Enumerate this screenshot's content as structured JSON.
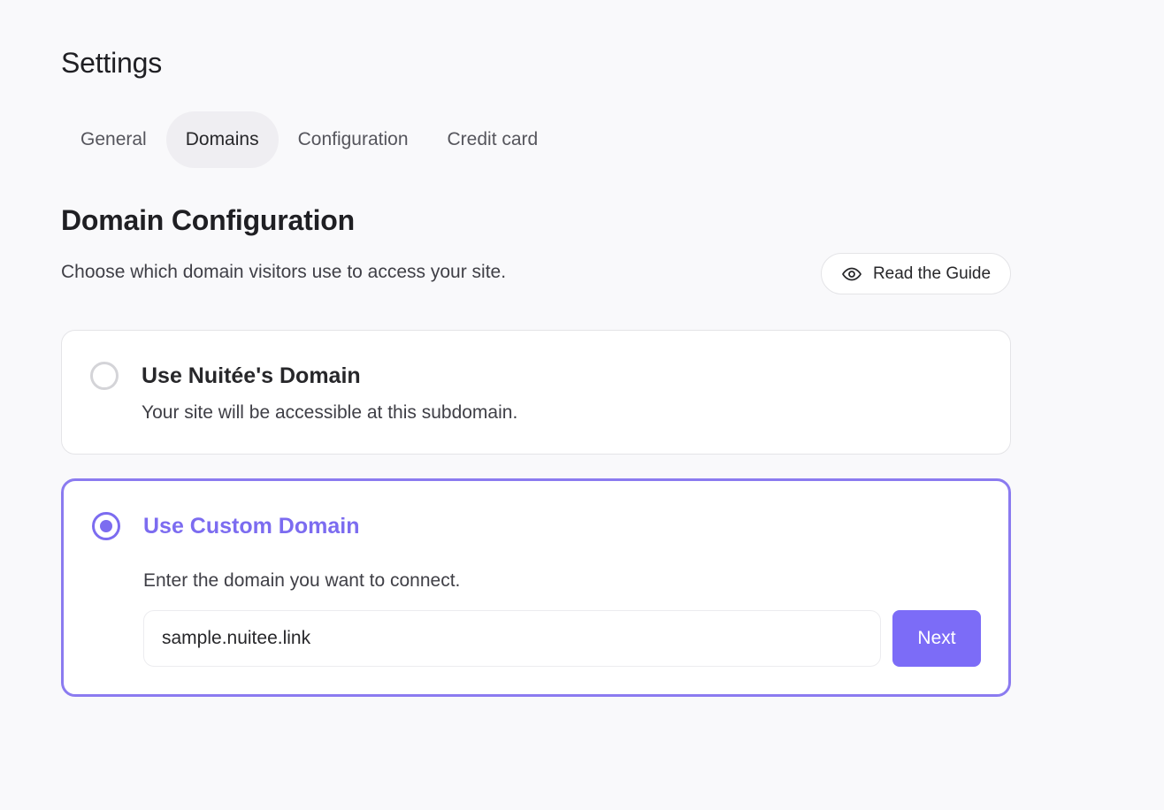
{
  "page": {
    "title": "Settings"
  },
  "tabs": [
    {
      "label": "General",
      "active": false
    },
    {
      "label": "Domains",
      "active": true
    },
    {
      "label": "Configuration",
      "active": false
    },
    {
      "label": "Credit card",
      "active": false
    }
  ],
  "section": {
    "title": "Domain Configuration",
    "description": "Choose which domain visitors use to access your site.",
    "guide_button": {
      "label": "Read the Guide",
      "icon": "eye-icon"
    }
  },
  "options": {
    "nuitee": {
      "title": "Use Nuitée's Domain",
      "description": "Your site will be accessible at this subdomain.",
      "selected": false
    },
    "custom": {
      "title": "Use Custom Domain",
      "description": "Enter the domain you want to connect.",
      "selected": true,
      "input_value": "sample.nuitee.link",
      "next_label": "Next"
    }
  },
  "colors": {
    "accent": "#7c6cf7",
    "background": "#f9f9fb",
    "card_border": "#e4e4e7",
    "selected_border": "#8b7bf0"
  }
}
